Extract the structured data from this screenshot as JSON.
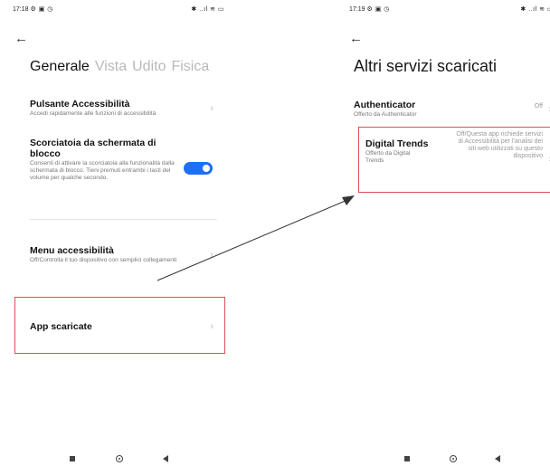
{
  "left_screen": {
    "status": {
      "time": "17:18",
      "icons": "⚙ ▣ ◷",
      "right_icons": "✱ ..ıl ≋ ▭"
    },
    "tabs": [
      "Generale",
      "Vista",
      "Udito",
      "Fisica"
    ],
    "items": [
      {
        "title": "Pulsante Accessibilità",
        "subtitle": "Accedi rapidamente alle funzioni di accessibilità"
      },
      {
        "title": "Scorciatoia da schermata di blocco",
        "subtitle": "Consenti di attivare la scorciatoia alla funzionalità dalla schermata di blocco. Tieni premuti entrambi i tasti del volume per qualche secondo.",
        "toggle_on": true
      },
      {
        "title": "Menu accessibilità",
        "subtitle": "Off/Controlla il tuo dispositivo con semplici collegamenti"
      },
      {
        "title": "App scaricate"
      }
    ]
  },
  "right_screen": {
    "status": {
      "time": "17:19",
      "icons": "⚙ ▣ ◷",
      "right_icons": "✱ ..ıl ≋ ▭"
    },
    "title": "Altri servizi scaricati",
    "items": [
      {
        "title": "Authenticator",
        "subtitle": "Offerto da Authenticator",
        "value": "Off"
      },
      {
        "title": "Digital Trends",
        "subtitle": "Offerto da Digital Trends",
        "value": "Off/Questa app richiede servizi di Accessibilità per l'analisi dei siti web utilizzati su questo dispositivo"
      }
    ]
  },
  "icons": {
    "back": "arrow-left-icon",
    "chevron": "chevron-right-icon",
    "nav": [
      "square-icon",
      "circle-icon",
      "triangle-back-icon"
    ]
  },
  "colors": {
    "accent": "#1f6ff5",
    "highlight": "#d94f55",
    "inactive_tab": "#b9b9b9"
  }
}
